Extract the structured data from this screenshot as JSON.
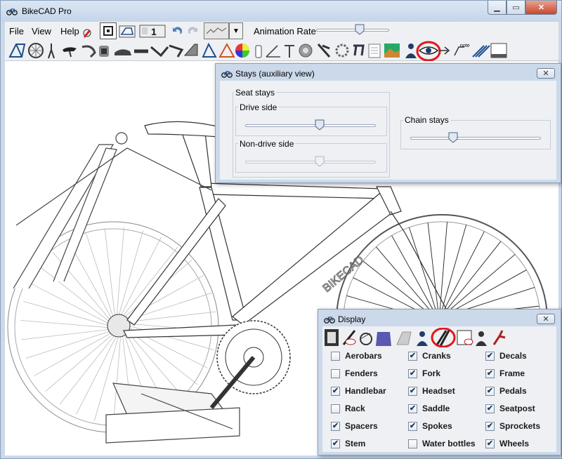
{
  "window": {
    "title": "BikeCAD Pro"
  },
  "menu": {
    "file": "File",
    "view": "View",
    "help": "Help"
  },
  "animation": {
    "label": "Animation Rate",
    "value": 0.6
  },
  "stays_dialog": {
    "title": "Stays (auxiliary view)",
    "seat_stays_label": "Seat stays",
    "drive_side_label": "Drive side",
    "drive_side_value": 0.57,
    "non_drive_side_label": "Non-drive side",
    "non_drive_side_value": 0.57,
    "chain_stays_label": "Chain stays",
    "chain_stays_value": 0.33
  },
  "display_dialog": {
    "title": "Display",
    "items": [
      {
        "label": "Aerobars",
        "checked": false
      },
      {
        "label": "Cranks",
        "checked": true
      },
      {
        "label": "Decals",
        "checked": true
      },
      {
        "label": "Fenders",
        "checked": false
      },
      {
        "label": "Fork",
        "checked": true
      },
      {
        "label": "Frame",
        "checked": true
      },
      {
        "label": "Handlebar",
        "checked": true
      },
      {
        "label": "Headset",
        "checked": true
      },
      {
        "label": "Pedals",
        "checked": true
      },
      {
        "label": "Rack",
        "checked": false
      },
      {
        "label": "Saddle",
        "checked": true
      },
      {
        "label": "Seatpost",
        "checked": true
      },
      {
        "label": "Spacers",
        "checked": true
      },
      {
        "label": "Spokes",
        "checked": true
      },
      {
        "label": "Sprockets",
        "checked": true
      },
      {
        "label": "Stem",
        "checked": true
      },
      {
        "label": "Water bottles",
        "checked": false
      },
      {
        "label": "Wheels",
        "checked": true
      }
    ]
  },
  "canvas": {
    "decal_text": "BIKECAD",
    "note_label": "note"
  },
  "colors": {
    "highlight_circle": "#e3161b",
    "accent": "#1e4f8f"
  }
}
